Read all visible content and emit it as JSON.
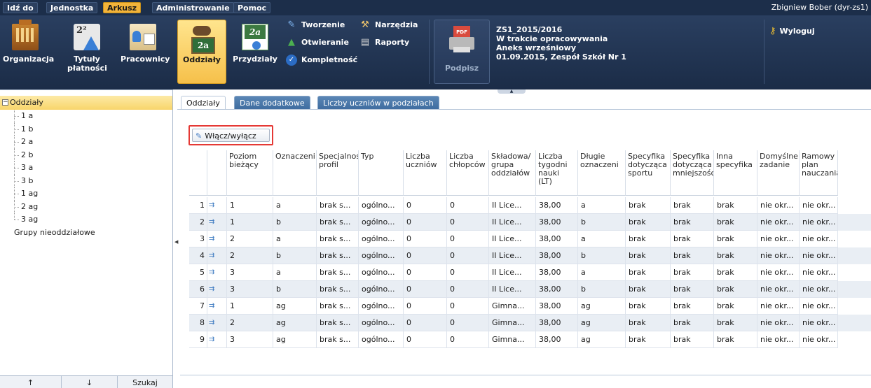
{
  "menu": {
    "items": [
      {
        "label": "Idź do",
        "active": false
      },
      {
        "label": "Jednostka",
        "active": false
      },
      {
        "label": "Arkusz",
        "active": true
      },
      {
        "label": "Administrowanie",
        "active": false
      },
      {
        "label": "Pomoc",
        "active": false
      }
    ],
    "user": "Zbigniew Bober (dyr-zs1)"
  },
  "ribbon": {
    "organizacja": "Organizacja",
    "tytuly_line1": "Tytuły",
    "tytuly_line2": "płatności",
    "pracownicy": "Pracownicy",
    "oddzialy": "Oddziały",
    "przydzialy": "Przydziały",
    "tworzenie": "Tworzenie",
    "narzedzia": "Narzędzia",
    "otwieranie": "Otwieranie",
    "raporty": "Raporty",
    "kompletnosc": "Kompletność",
    "podpisz": "Podpisz",
    "pdf": "PDF",
    "wyloguj": "Wyloguj",
    "sheet_name": "ZS1_2015/2016",
    "sheet_status": "W trakcie opracowywania",
    "sheet_type": "Aneks wrześniowy",
    "sheet_date_school": "01.09.2015, Zespół Szkół Nr 1"
  },
  "tree": {
    "root": "Oddziały",
    "items": [
      "1 a",
      "1 b",
      "2 a",
      "2 b",
      "3 a",
      "3 b",
      "1 ag",
      "2 ag",
      "3 ag"
    ],
    "other": "Grupy nieoddziałowe"
  },
  "left_buttons": {
    "up": "↑",
    "down": "↓",
    "search": "Szukaj"
  },
  "tabs": [
    "Oddziały",
    "Dane dodatkowe",
    "Liczby uczniów w podziałach"
  ],
  "toggle_button": "Włącz/wyłącz",
  "grid": {
    "headers": [
      [
        "Poziom",
        "bieżący"
      ],
      [
        "Oznaczeni"
      ],
      [
        "Specjalnoś",
        "profil"
      ],
      [
        "Typ"
      ],
      [
        "Liczba",
        "uczniów"
      ],
      [
        "Liczba",
        "chłopców"
      ],
      [
        "Składowa/",
        "grupa",
        "oddziałów"
      ],
      [
        "Liczba",
        "tygodni",
        "nauki",
        "(LT)"
      ],
      [
        "Długie",
        "oznaczeni"
      ],
      [
        "Specyfika",
        "dotycząca",
        "sportu"
      ],
      [
        "Specyfika",
        "dotycząca",
        "mniejszośc"
      ],
      [
        "Inna",
        "specyfika"
      ],
      [
        "Domyślne",
        "zadanie"
      ],
      [
        "Ramowy",
        "plan",
        "nauczania"
      ]
    ],
    "rows": [
      [
        "1",
        "1",
        "a",
        "brak s...",
        "ogólno...",
        "0",
        "0",
        "II Lice...",
        "38,00",
        "a",
        "brak",
        "brak",
        "brak",
        "nie okr...",
        "nie okr..."
      ],
      [
        "2",
        "1",
        "b",
        "brak s...",
        "ogólno...",
        "0",
        "0",
        "II Lice...",
        "38,00",
        "b",
        "brak",
        "brak",
        "brak",
        "nie okr...",
        "nie okr..."
      ],
      [
        "3",
        "2",
        "a",
        "brak s...",
        "ogólno...",
        "0",
        "0",
        "II Lice...",
        "38,00",
        "a",
        "brak",
        "brak",
        "brak",
        "nie okr...",
        "nie okr..."
      ],
      [
        "4",
        "2",
        "b",
        "brak s...",
        "ogólno...",
        "0",
        "0",
        "II Lice...",
        "38,00",
        "b",
        "brak",
        "brak",
        "brak",
        "nie okr...",
        "nie okr..."
      ],
      [
        "5",
        "3",
        "a",
        "brak s...",
        "ogólno...",
        "0",
        "0",
        "II Lice...",
        "38,00",
        "a",
        "brak",
        "brak",
        "brak",
        "nie okr...",
        "nie okr..."
      ],
      [
        "6",
        "3",
        "b",
        "brak s...",
        "ogólno...",
        "0",
        "0",
        "II Lice...",
        "38,00",
        "b",
        "brak",
        "brak",
        "brak",
        "nie okr...",
        "nie okr..."
      ],
      [
        "7",
        "1",
        "ag",
        "brak s...",
        "ogólno...",
        "0",
        "0",
        "Gimna...",
        "38,00",
        "ag",
        "brak",
        "brak",
        "brak",
        "nie okr...",
        "nie okr..."
      ],
      [
        "8",
        "2",
        "ag",
        "brak s...",
        "ogólno...",
        "0",
        "0",
        "Gimna...",
        "38,00",
        "ag",
        "brak",
        "brak",
        "brak",
        "nie okr...",
        "nie okr..."
      ],
      [
        "9",
        "3",
        "ag",
        "brak s...",
        "ogólno...",
        "0",
        "0",
        "Gimna...",
        "38,00",
        "ag",
        "brak",
        "brak",
        "brak",
        "nie okr...",
        "nie okr..."
      ]
    ]
  }
}
